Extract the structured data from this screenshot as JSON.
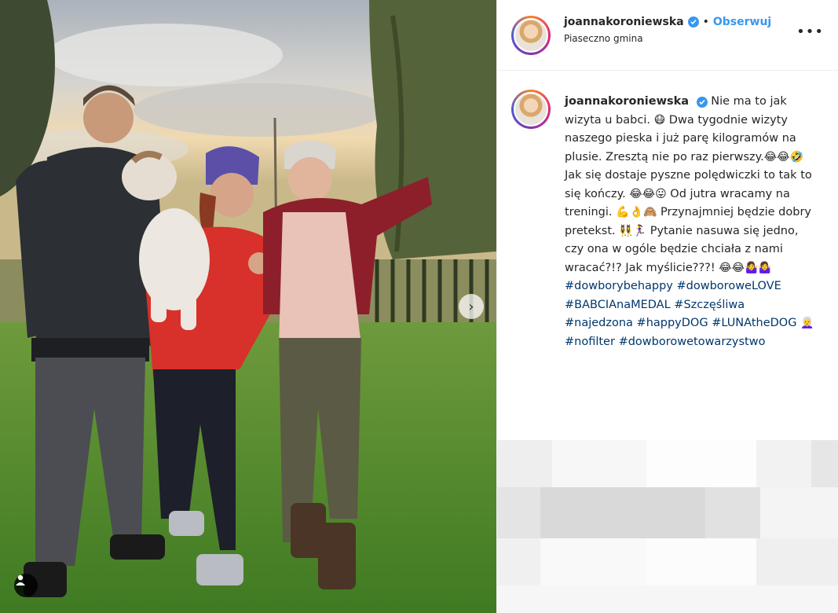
{
  "post": {
    "username": "joannakoroniewska",
    "location": "Piaseczno gmina",
    "follow_label": "Obserwuj",
    "separator": "•",
    "more_label": "•••",
    "verified": true
  },
  "caption": {
    "username": "joannakoroniewska",
    "text_1": "Nie ma to jak wizyta u babci.",
    "emoji_1": "😷",
    "text_2": "Dwa tygodnie wizyty naszego pieska i już parę kilogramów na plusie. Zresztą nie po raz pierwszy.",
    "emoji_2": "😂😂🤣",
    "text_3": "Jak się dostaje pyszne polędwiczki to tak to się kończy.",
    "emoji_3": "😂😂😛",
    "text_4": "Od jutra wracamy na treningi.",
    "emoji_4": "💪👌🙈",
    "text_5": "Przynajmniej będzie dobry pretekst.",
    "emoji_5": "👯‍♀️🏃‍♀️",
    "text_6": "Pytanie nasuwa się jedno, czy ona w ogóle będzie chciała z nami wracać?!? Jak myślicie???!",
    "emoji_6": "😂😂🤷‍♀️🤷‍♀️",
    "hashtags": [
      "#dowborybehappy",
      "#dowboroweLOVE",
      "#BABCIAnaMEDAL",
      "#Szczęśliwa",
      "#najedzona",
      "#happyDOG",
      "#LUNAtheDOG",
      "#nofilter",
      "#dowborowetowarzystwo"
    ],
    "emoji_7": "👩‍🦳"
  },
  "photo": {
    "next_icon": "chevron-right-icon",
    "tag_icon": "user-tag-icon"
  },
  "colors": {
    "accent": "#3897f0",
    "hashtag": "#00376b",
    "text": "#262626",
    "border": "#efefef"
  }
}
